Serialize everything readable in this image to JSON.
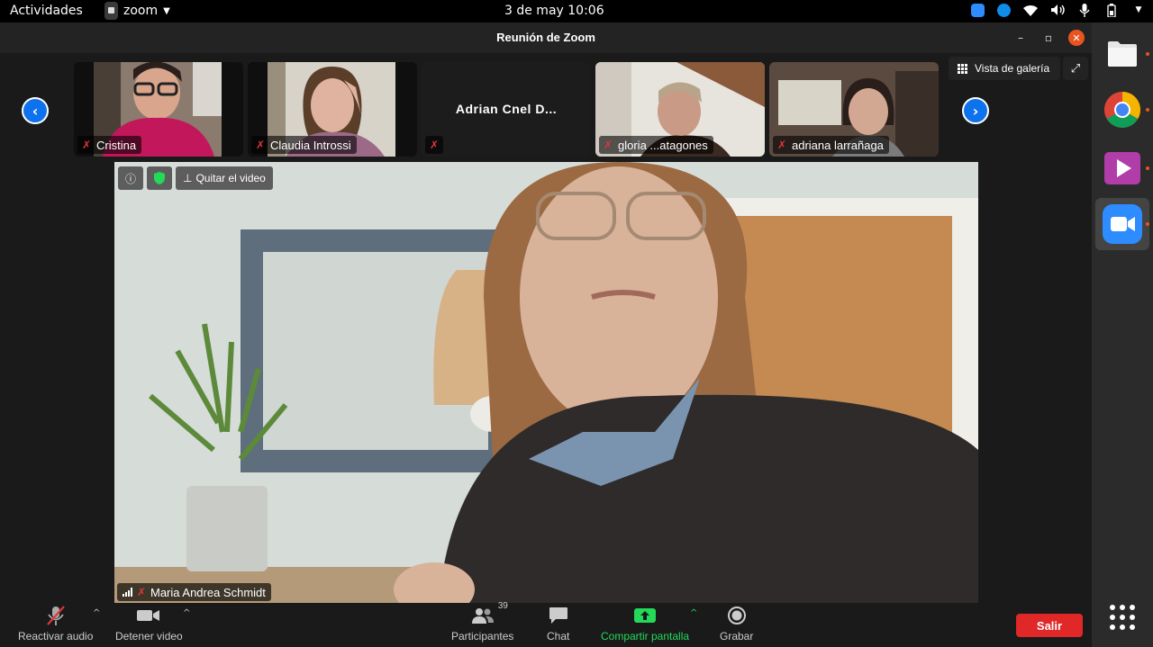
{
  "topbar": {
    "activities": "Actividades",
    "app_name": "zoom",
    "app_menu_icon": "caret-down-icon",
    "clock": "3 de may  10:06",
    "tray_icons": [
      "zoom-tray-icon",
      "teamviewer-icon",
      "wifi-icon",
      "volume-icon",
      "microphone-icon",
      "battery-icon",
      "caret-down-icon"
    ]
  },
  "window": {
    "title": "Reunión de Zoom",
    "minimize": "–",
    "restore": "▫",
    "close": "✕"
  },
  "gallery": {
    "prev_arrow": "‹",
    "next_arrow": "›",
    "gallery_view_label": "Vista de galería",
    "fullscreen_icon": "⤢",
    "participants": [
      {
        "name": "Cristina",
        "muted": true,
        "video": true
      },
      {
        "name": "Claudia Introssi",
        "muted": true,
        "video": true
      },
      {
        "name": "Adrian Cnel D...",
        "muted": true,
        "video": false
      },
      {
        "name": "gloria ...atagones",
        "muted": true,
        "video": true
      },
      {
        "name": "adriana larrañaga",
        "muted": true,
        "video": true
      }
    ]
  },
  "main_video": {
    "info_icon": "ⓘ",
    "pin_label": "Quitar el video",
    "speaker_name": "Maria Andrea Schmidt",
    "muted": true
  },
  "toolbar": {
    "audio_label": "Reactivar audio",
    "video_label": "Detener video",
    "participants_label": "Participantes",
    "participants_count": "39",
    "chat_label": "Chat",
    "share_label": "Compartir pantalla",
    "record_label": "Grabar",
    "leave_label": "Salir",
    "caret": "^"
  },
  "colors": {
    "accent_blue": "#0e72ed",
    "leave_red": "#e02828",
    "share_green": "#23d959",
    "mute_red": "#e0363a",
    "ubuntu_orange": "#e95420"
  },
  "dock": {
    "items": [
      "files-icon",
      "chrome-icon",
      "video-player-icon",
      "zoom-icon"
    ],
    "apps_grid": "show-apps-icon"
  }
}
